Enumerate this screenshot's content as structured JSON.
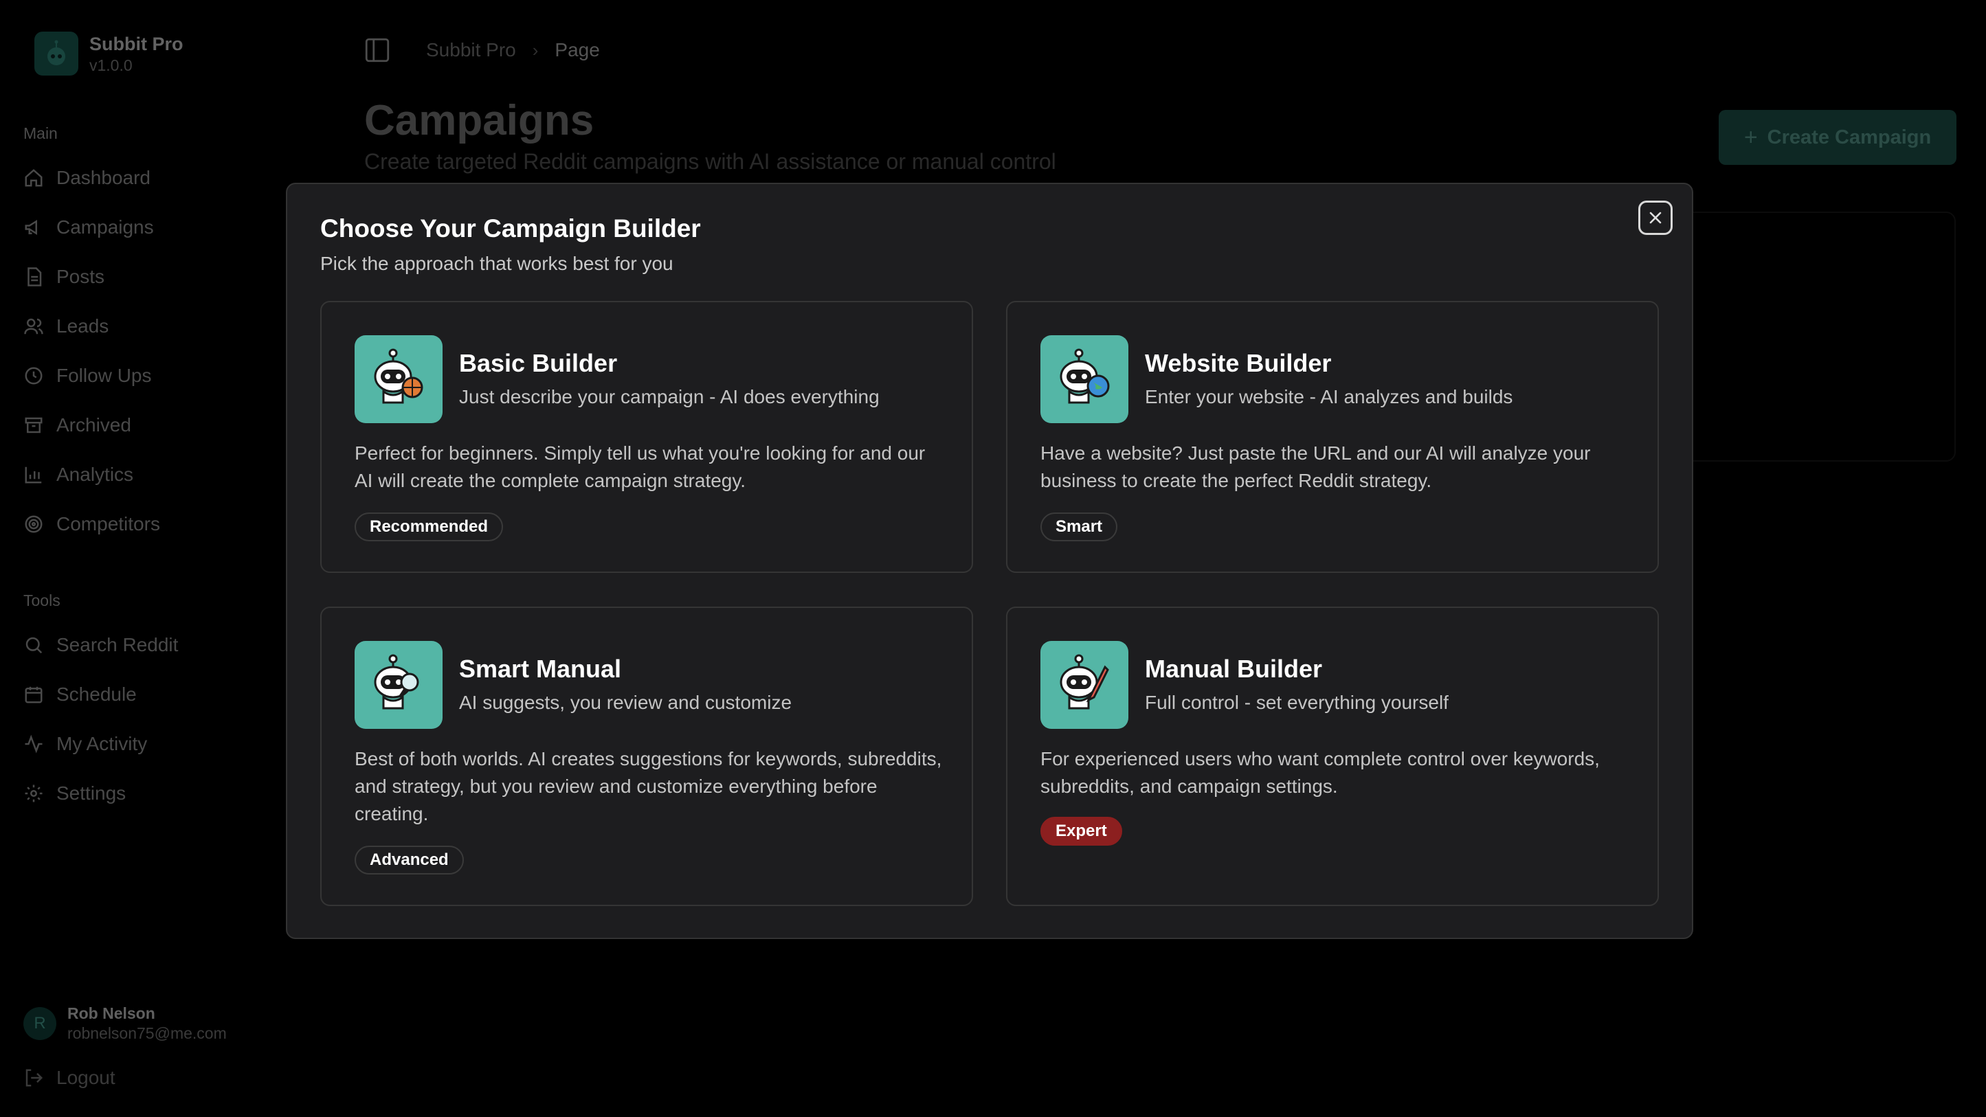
{
  "app": {
    "name": "Subbit Pro",
    "version": "v1.0.0"
  },
  "sidebar": {
    "main_label": "Main",
    "main_items": [
      {
        "label": "Dashboard",
        "icon": "home-icon"
      },
      {
        "label": "Campaigns",
        "icon": "megaphone-icon"
      },
      {
        "label": "Posts",
        "icon": "document-icon"
      },
      {
        "label": "Leads",
        "icon": "users-icon"
      },
      {
        "label": "Follow Ups",
        "icon": "clock-icon"
      },
      {
        "label": "Archived",
        "icon": "archive-icon"
      },
      {
        "label": "Analytics",
        "icon": "bar-chart-icon"
      },
      {
        "label": "Competitors",
        "icon": "target-icon"
      }
    ],
    "tools_label": "Tools",
    "tools_items": [
      {
        "label": "Search Reddit",
        "icon": "search-icon"
      },
      {
        "label": "Schedule",
        "icon": "calendar-icon"
      },
      {
        "label": "My Activity",
        "icon": "activity-icon"
      },
      {
        "label": "Settings",
        "icon": "gear-icon"
      }
    ],
    "user": {
      "initial": "R",
      "name": "Rob Nelson",
      "email": "robnelson75@me.com"
    },
    "logout_label": "Logout"
  },
  "breadcrumb": {
    "root": "Subbit Pro",
    "current": "Page"
  },
  "page": {
    "title": "Campaigns",
    "subtitle": "Create targeted Reddit campaigns with AI assistance or manual control",
    "create_button": "Create Campaign"
  },
  "modal": {
    "title": "Choose Your Campaign Builder",
    "subtitle": "Pick the approach that works best for you",
    "cards": [
      {
        "title": "Basic Builder",
        "tagline": "Just describe your campaign - AI does everything",
        "description": "Perfect for beginners. Simply tell us what you're looking for and our AI will create the complete campaign strategy.",
        "badge": "Recommended",
        "icon": "robot-basketball-icon"
      },
      {
        "title": "Website Builder",
        "tagline": "Enter your website - AI analyzes and builds",
        "description": "Have a website? Just paste the URL and our AI will analyze your business to create the perfect Reddit strategy.",
        "badge": "Smart",
        "icon": "robot-globe-icon"
      },
      {
        "title": "Smart Manual",
        "tagline": "AI suggests, you review and customize",
        "description": "Best of both worlds. AI creates suggestions for keywords, subreddits, and strategy, but you review and customize everything before creating.",
        "badge": "Advanced",
        "icon": "robot-magnifier-icon"
      },
      {
        "title": "Manual Builder",
        "tagline": "Full control - set everything yourself",
        "description": "For experienced users who want complete control over keywords, subreddits, and campaign settings.",
        "badge": "Expert",
        "icon": "robot-pencil-icon"
      }
    ]
  },
  "colors": {
    "accent": "#54b6a6",
    "expert_badge": "#8c1f1f",
    "modal_bg": "#1d1d1f"
  }
}
